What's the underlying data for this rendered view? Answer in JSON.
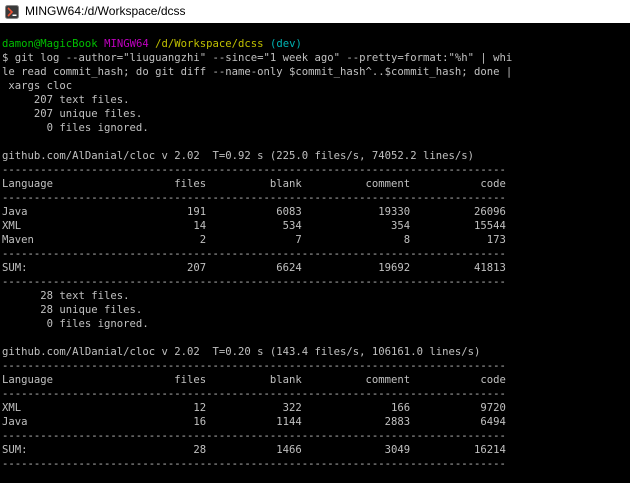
{
  "window": {
    "title": "MINGW64:/d/Workspace/dcss"
  },
  "prompt": {
    "user_host": "damon@MagicBook",
    "shell": "MINGW64",
    "path": "/d/Workspace/dcss",
    "branch": "(dev)"
  },
  "command_lines": [
    "$ git log --author=\"liuguangzhi\" --since=\"1 week ago\" --pretty=format:\"%h\" | whi",
    "le read commit_hash; do git diff --name-only $commit_hash^..$commit_hash; done |",
    " xargs cloc"
  ],
  "block1": {
    "summary": [
      "     207 text files.",
      "     207 unique files.",
      "       0 files ignored."
    ],
    "header_line": "github.com/AlDanial/cloc v 2.02  T=0.92 s (225.0 files/s, 74052.2 lines/s)",
    "separator": "-------------------------------------------------------------------------------",
    "columns": [
      "Language",
      "files",
      "blank",
      "comment",
      "code"
    ],
    "rows": [
      [
        "Java",
        "191",
        "6083",
        "19330",
        "26096"
      ],
      [
        "XML",
        "14",
        "534",
        "354",
        "15544"
      ],
      [
        "Maven",
        "2",
        "7",
        "8",
        "173"
      ]
    ],
    "sum": [
      "SUM:",
      "207",
      "6624",
      "19692",
      "41813"
    ]
  },
  "block2": {
    "summary": [
      "      28 text files.",
      "      28 unique files.",
      "       0 files ignored."
    ],
    "header_line": "github.com/AlDanial/cloc v 2.02  T=0.20 s (143.4 files/s, 106161.0 lines/s)",
    "separator": "-------------------------------------------------------------------------------",
    "columns": [
      "Language",
      "files",
      "blank",
      "comment",
      "code"
    ],
    "rows": [
      [
        "XML",
        "12",
        "322",
        "166",
        "9720"
      ],
      [
        "Java",
        "16",
        "1144",
        "2883",
        "6494"
      ]
    ],
    "sum": [
      "SUM:",
      "28",
      "1466",
      "3049",
      "16214"
    ]
  },
  "colors": {
    "prompt_user": "#00c000",
    "prompt_shell": "#c000c0",
    "prompt_path": "#c0c000",
    "prompt_branch": "#00b4b4",
    "text": "#c0c0c0",
    "background": "#000000"
  }
}
